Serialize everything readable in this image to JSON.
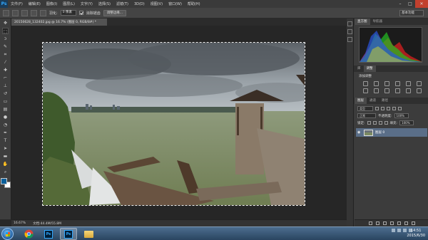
{
  "app": {
    "logo": "Ps"
  },
  "menu": [
    "文件(F)",
    "编辑(E)",
    "图像(I)",
    "图层(L)",
    "文字(Y)",
    "选择(S)",
    "滤镜(T)",
    "3D(D)",
    "视图(V)",
    "窗口(W)",
    "帮助(H)"
  ],
  "options": {
    "feather_label": "羽化:",
    "feather_value": "0 像素",
    "antialias_label": "消除锯齿",
    "refine_edge_button": "调整边缘...",
    "workspace": "基本功能"
  },
  "document": {
    "tab_title": "20150628_132402.jpg @ 16.7% (图层 0, RGB/8#) *",
    "zoom": "16.67%",
    "doc_size": "文档:44.4M/55.8M"
  },
  "panels": {
    "histogram_tabs": [
      "直方图",
      "导航器"
    ],
    "adjustment_tabs": [
      "库",
      "调整"
    ],
    "adjustments_title": "添加调整",
    "layer_tabs": [
      "图层",
      "通道",
      "路径"
    ],
    "kind_filter": "类型",
    "blend_mode": "正常",
    "opacity_label": "不透明度:",
    "opacity_value": "100%",
    "lock_label": "锁定:",
    "fill_label": "填充:",
    "fill_value": "100%",
    "layer_name": "图层 0"
  },
  "taskbar": {
    "time": "14:51",
    "date": "2015/6/30"
  },
  "colors": {
    "foreground": "#0b5f9a",
    "background": "#ffffff",
    "layer_selected": "#5a6e88"
  }
}
